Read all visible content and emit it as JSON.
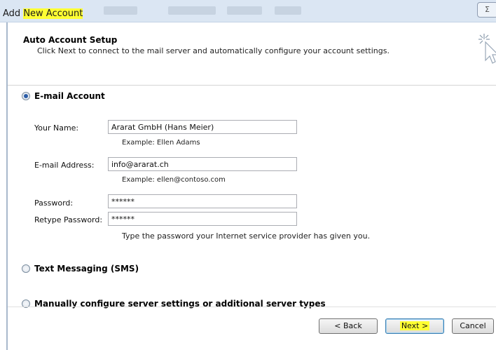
{
  "window": {
    "title_prefix": "Add ",
    "title_highlight": "New Account",
    "close_label": "Σ"
  },
  "header": {
    "title": "Auto Account Setup",
    "subtitle": "Click Next to connect to the mail server and automatically configure your account settings."
  },
  "options": {
    "email_account": {
      "label": "E-mail Account",
      "selected": true
    },
    "sms": {
      "label": "Text Messaging (SMS)",
      "selected": false
    },
    "manual": {
      "label": "Manually configure server settings or additional server types",
      "selected": false
    }
  },
  "form": {
    "name_label": "Your Name:",
    "name_value": "Ararat GmbH (Hans Meier)",
    "name_example": "Example: Ellen Adams",
    "email_label": "E-mail Address:",
    "email_value": "info@ararat.ch",
    "email_example": "Example: ellen@contoso.com",
    "password_label": "Password:",
    "password_value": "******",
    "retype_label": "Retype Password:",
    "retype_value": "******",
    "password_hint": "Type the password your Internet service provider has given you."
  },
  "buttons": {
    "back": "< Back",
    "next": "Next >",
    "cancel": "Cancel"
  },
  "colors": {
    "highlight": "#ffff33",
    "radio_selected": "#2b5da8"
  }
}
